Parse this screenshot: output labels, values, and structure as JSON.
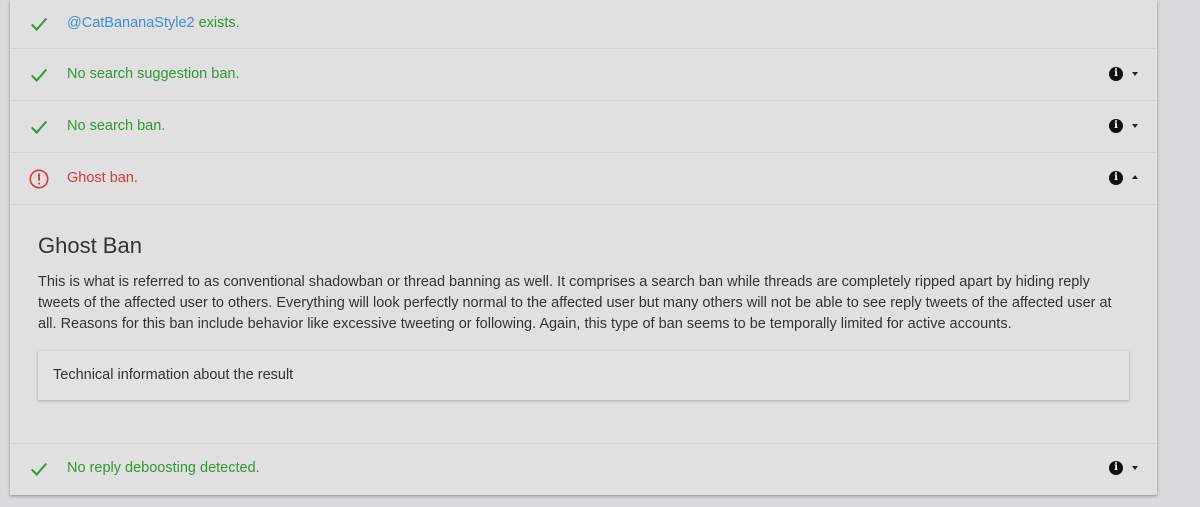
{
  "checks": {
    "exists": {
      "username": "@CatBananaStyle2",
      "text": " exists.",
      "status": "ok",
      "status_icon": "check-icon"
    },
    "search_suggestion": {
      "text": "No search suggestion ban.",
      "status": "ok",
      "status_icon": "check-icon"
    },
    "search": {
      "text": "No search ban.",
      "status": "ok",
      "status_icon": "check-icon"
    },
    "ghost": {
      "text": "Ghost ban.",
      "status": "error",
      "status_icon": "alert-circle-icon",
      "expanded": true
    },
    "reply_deboosting": {
      "text": "No reply deboosting detected.",
      "status": "ok",
      "status_icon": "check-icon"
    }
  },
  "ghost_details": {
    "title": "Ghost Ban",
    "description": "This is what is referred to as conventional shadowban or thread banning as well. It comprises a search ban while threads are completely ripped apart by hiding reply tweets of the affected user to others. Everything will look perfectly normal to the affected user but many others will not be able to see reply tweets of the affected user at all. Reasons for this ban include behavior like excessive tweeting or following. Again, this type of ban seems to be temporally limited for active accounts.",
    "technical_info_label": "Technical information about the result"
  },
  "icons": {
    "info": "info-icon",
    "expand": "chevron-down-icon",
    "collapse": "chevron-up-icon"
  },
  "colors": {
    "success": "#2f9a2f",
    "error": "#d63b3b",
    "link": "#3d8fd1"
  }
}
